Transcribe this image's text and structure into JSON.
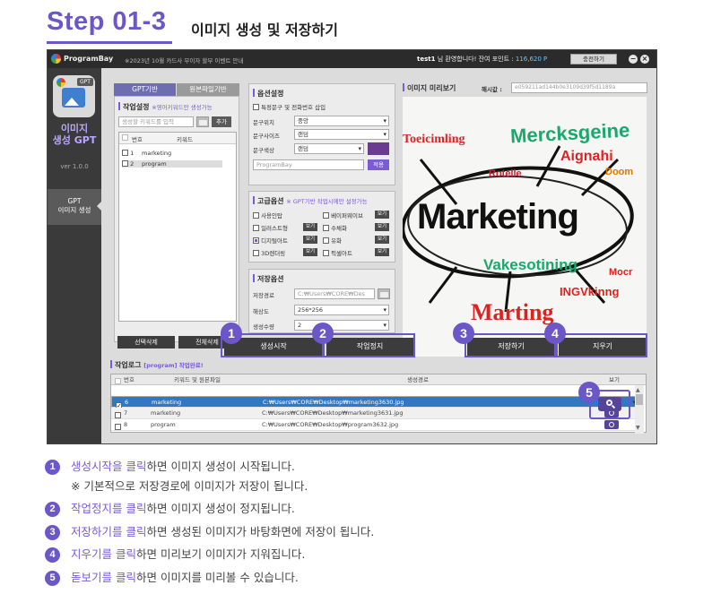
{
  "header": {
    "step_title": "Step 01-3",
    "subtitle": "이미지 생성 및 저장하기"
  },
  "app": {
    "brand": "ProgramBay",
    "notice": "※2023년 10월 카드사 무이자 할부 이벤트 안내",
    "user": "test1",
    "greeting": "님 환영합니다! 잔여 포인트 :",
    "points": "116,620 P",
    "charge_button": "충전하기",
    "sidebar": {
      "name_line1": "이미지",
      "name_line2": "생성 GPT",
      "version": "ver 1.0.0",
      "menu_line1": "GPT",
      "menu_line2": "이미지 생성",
      "icon_badge": "GPT"
    },
    "tabs": [
      "GPT기반",
      "원본파일기반"
    ],
    "work_setting": {
      "title": "작업설정",
      "note": "※영어키워드만 생성가능",
      "keyword_placeholder": "생성할 키워드를 입력",
      "add_button": "추가",
      "columns": [
        "번호",
        "키워드"
      ],
      "rows": [
        {
          "no": "1",
          "keyword": "marketing"
        },
        {
          "no": "2",
          "keyword": "program"
        }
      ],
      "select_delete": "선택삭제",
      "delete_all": "전체삭제"
    },
    "options": {
      "title": "옵션설정",
      "special_text": "특정문구 및 전화번호 삽입",
      "position_label": "문구위치",
      "position_value": "중앙",
      "size_label": "문구사이즈",
      "size_value": "랜덤",
      "color_label": "문구색상",
      "color_value": "랜덤",
      "text_value": "ProgramBay",
      "apply_button": "적용"
    },
    "advanced": {
      "title": "고급옵션",
      "note": "※ GPT기반 작업시에만 설정가능",
      "items": [
        {
          "label": "사용인탑",
          "view": ""
        },
        {
          "label": "베이퍼웨이브",
          "view": "보기"
        },
        {
          "label": "일러스트형",
          "view": "보기"
        },
        {
          "label": "수채화",
          "view": "보기"
        },
        {
          "label": "디지털아트",
          "view": "보기"
        },
        {
          "label": "유화",
          "view": "보기"
        },
        {
          "label": "3D렌더링",
          "view": "보기"
        },
        {
          "label": "픽셀아트",
          "view": "보기"
        }
      ]
    },
    "save_options": {
      "title": "저장옵션",
      "path_label": "저장경로",
      "path_value": "C:₩Users₩CORE₩Des",
      "resolution_label": "해상도",
      "resolution_value": "256*256",
      "count_label": "생성수량",
      "count_value": "2"
    },
    "preview": {
      "title": "이미지 미리보기",
      "seed_label": "해시값 :",
      "seed_value": "e059211ad144b0e3109d39f5d1189a"
    },
    "buttons": {
      "start": "생성시작",
      "stop": "작업정지",
      "save": "저장하기",
      "clear": "지우기"
    },
    "log": {
      "title": "작업로그",
      "status": "[program] 작업완료!",
      "columns": [
        "번호",
        "키워드 및 원본파일",
        "생성경로",
        "보기"
      ],
      "rows": [
        {
          "no": "6",
          "keyword": "marketing",
          "path": "C:₩Users₩CORE₩Desktop₩marketing3630.jpg"
        },
        {
          "no": "7",
          "keyword": "marketing",
          "path": "C:₩Users₩CORE₩Desktop₩marketing3631.jpg"
        },
        {
          "no": "8",
          "keyword": "program",
          "path": "C:₩Users₩CORE₩Desktop₩program3632.jpg"
        }
      ]
    },
    "art_words": {
      "main": "Marketing",
      "w1": "Mercksgeine",
      "w2": "Toeicimling",
      "w3": "Aignahi",
      "w4": "Vakesotining",
      "w5": "Marting",
      "w6": "INGVkinng",
      "w7": "Rotelle",
      "w8": "Doom",
      "w9": "Mocr"
    }
  },
  "callouts": [
    "1",
    "2",
    "3",
    "4",
    "5"
  ],
  "descriptions": [
    {
      "num": "1",
      "hl": "생성시작을 클릭",
      "rest": "하면 이미지 생성이 시작됩니다."
    },
    {
      "num": "2",
      "hl": "작업정지를 클릭",
      "rest": "하면 이미지 생성이 정지됩니다."
    },
    {
      "num": "3",
      "hl": "저장하기를 클릭",
      "rest": "하면 생성된 이미지가 바탕화면에 저장이 됩니다."
    },
    {
      "num": "4",
      "hl": "지우기를 클릭",
      "rest": "하면 미리보기 이미지가 지워집니다."
    },
    {
      "num": "5",
      "hl": "돋보기를 클릭",
      "rest": "하면 이미지를 미리볼 수 있습니다."
    }
  ],
  "warning": "※ 기본적으로 저장경로에 이미지가 저장이 됩니다.",
  "colors": {
    "accent": "#6b57c7",
    "selected_row": "#2f78c4",
    "warning": "#c0392b"
  }
}
